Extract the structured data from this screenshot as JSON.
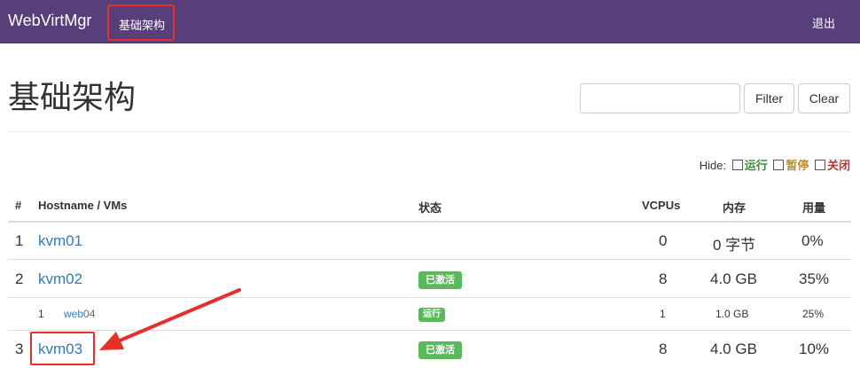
{
  "navbar": {
    "brand": "WebVirtMgr",
    "active_item": "基础架构",
    "logout": "退出"
  },
  "page": {
    "title": "基础架构"
  },
  "filter": {
    "placeholder": "",
    "filter_label": "Filter",
    "clear_label": "Clear"
  },
  "hide": {
    "label": "Hide:",
    "running": "运行",
    "paused": "暂停",
    "shutoff": "关闭"
  },
  "table": {
    "headers": {
      "index": "#",
      "hostname": "Hostname / VMs",
      "status": "状态",
      "vcpus": "VCPUs",
      "memory": "内存",
      "usage": "用量"
    },
    "rows": [
      {
        "index": "1",
        "name": "kvm01",
        "status": "",
        "vcpus": "0",
        "memory": "0 字节",
        "usage": "0%"
      },
      {
        "index": "2",
        "name": "kvm02",
        "status": "已激活",
        "vcpus": "8",
        "memory": "4.0 GB",
        "usage": "35%"
      },
      {
        "index": "1",
        "name": "web04",
        "status": "运行",
        "vcpus": "1",
        "memory": "1.0 GB",
        "usage": "25%"
      },
      {
        "index": "3",
        "name": "kvm03",
        "status": "已激活",
        "vcpus": "8",
        "memory": "4.0 GB",
        "usage": "10%"
      }
    ]
  },
  "colors": {
    "navbar_bg": "#593f7a",
    "link": "#337ab7",
    "badge_success": "#5cb85c",
    "highlight": "#e5302a"
  }
}
